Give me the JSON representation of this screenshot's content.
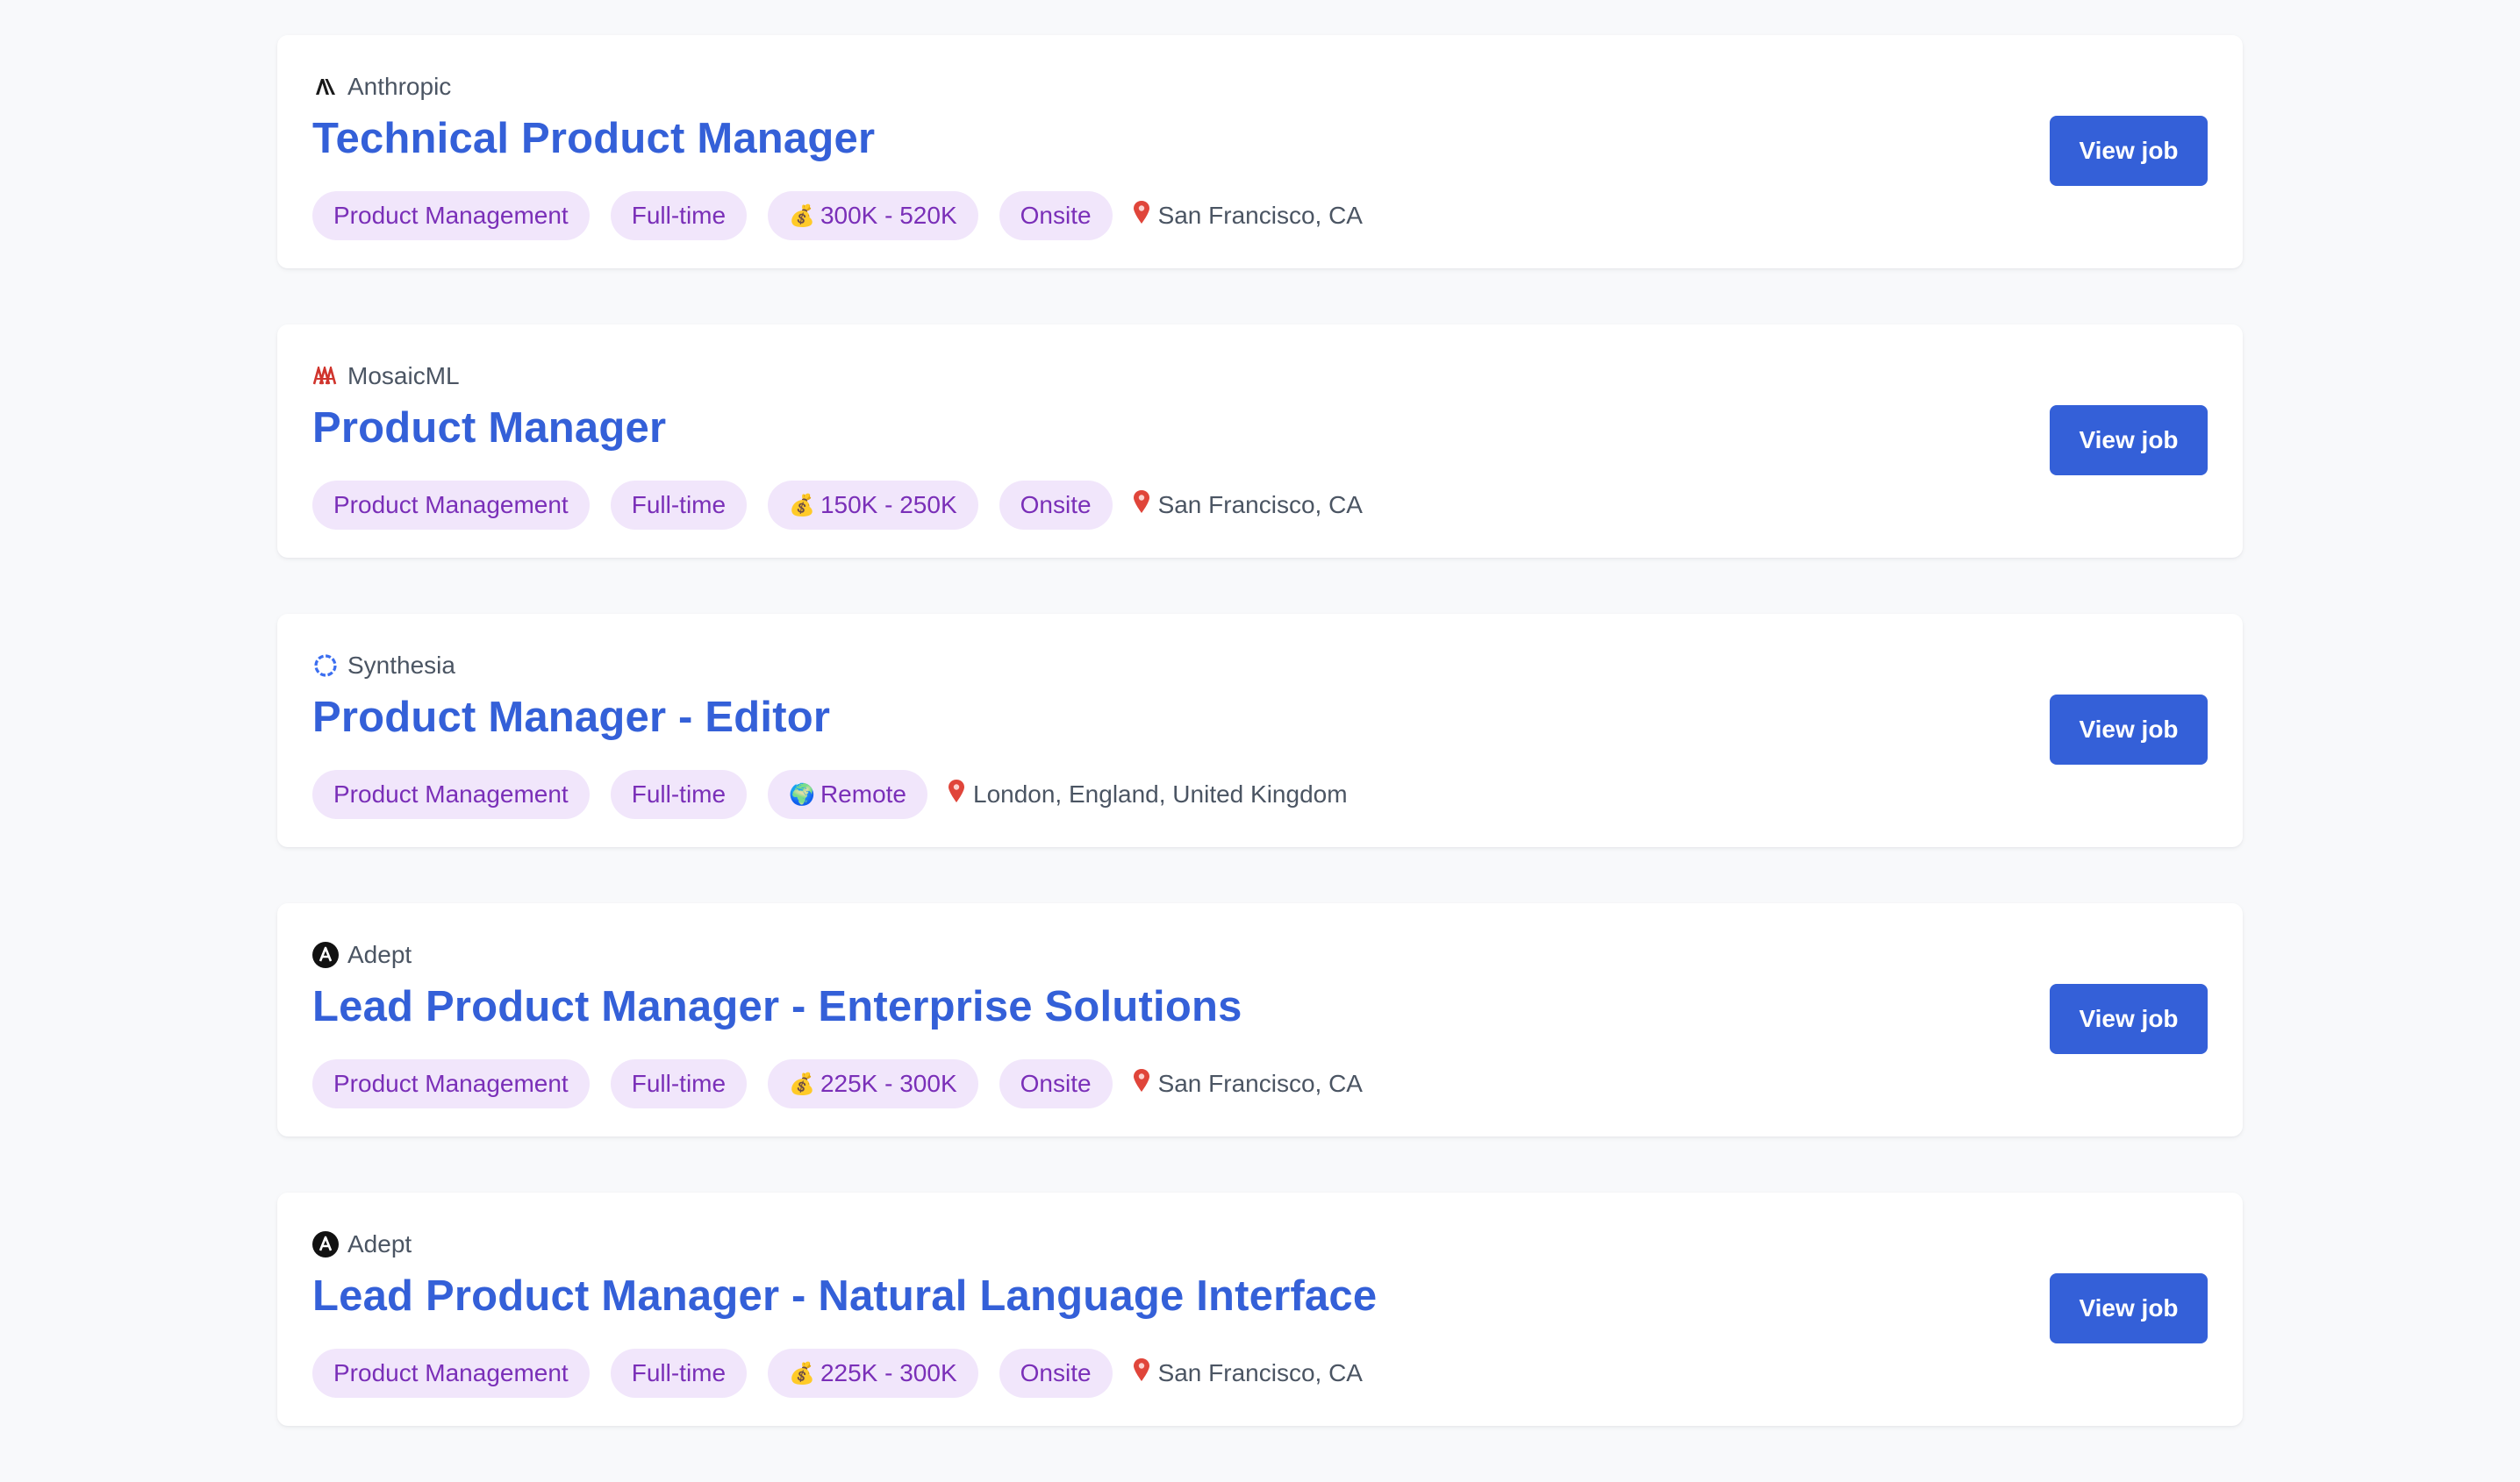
{
  "jobs": [
    {
      "company": "Anthropic",
      "logo": "anthropic-logo",
      "title": "Technical Product Manager",
      "tags": [
        {
          "text": "Product Management",
          "emoji": ""
        },
        {
          "text": "Full-time",
          "emoji": ""
        },
        {
          "text": "300K - 520K",
          "emoji": "💰"
        },
        {
          "text": "Onsite",
          "emoji": ""
        }
      ],
      "location": "San Francisco, CA",
      "button": "View job"
    },
    {
      "company": "MosaicML",
      "logo": "mosaicml-logo",
      "title": "Product Manager",
      "tags": [
        {
          "text": "Product Management",
          "emoji": ""
        },
        {
          "text": "Full-time",
          "emoji": ""
        },
        {
          "text": "150K - 250K",
          "emoji": "💰"
        },
        {
          "text": "Onsite",
          "emoji": ""
        }
      ],
      "location": "San Francisco, CA",
      "button": "View job"
    },
    {
      "company": "Synthesia",
      "logo": "synthesia-logo",
      "title": "Product Manager - Editor",
      "tags": [
        {
          "text": "Product Management",
          "emoji": ""
        },
        {
          "text": "Full-time",
          "emoji": ""
        },
        {
          "text": "Remote",
          "emoji": "🌍"
        }
      ],
      "location": "London, England, United Kingdom",
      "button": "View job"
    },
    {
      "company": "Adept",
      "logo": "adept-logo",
      "title": "Lead Product Manager - Enterprise Solutions",
      "tags": [
        {
          "text": "Product Management",
          "emoji": ""
        },
        {
          "text": "Full-time",
          "emoji": ""
        },
        {
          "text": "225K - 300K",
          "emoji": "💰"
        },
        {
          "text": "Onsite",
          "emoji": ""
        }
      ],
      "location": "San Francisco, CA",
      "button": "View job"
    },
    {
      "company": "Adept",
      "logo": "adept-logo",
      "title": "Lead Product Manager - Natural Language Interface",
      "tags": [
        {
          "text": "Product Management",
          "emoji": ""
        },
        {
          "text": "Full-time",
          "emoji": ""
        },
        {
          "text": "225K - 300K",
          "emoji": "💰"
        },
        {
          "text": "Onsite",
          "emoji": ""
        }
      ],
      "location": "San Francisco, CA",
      "button": "View job"
    }
  ],
  "colors": {
    "accent": "#3460d8",
    "tag_bg": "#f1e6fb",
    "tag_text": "#7a2fb8",
    "muted_text": "#4b5563",
    "page_bg": "#f8f9fb"
  }
}
